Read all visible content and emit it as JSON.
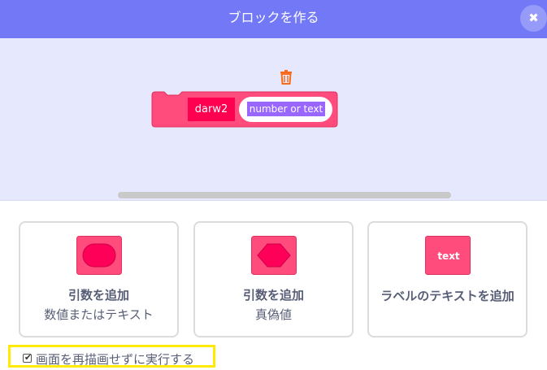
{
  "header": {
    "title": "ブロックを作る",
    "close_icon": "close-icon"
  },
  "workspace": {
    "block": {
      "label": "darw2",
      "input_text": "number or text",
      "color": "#ff4c7c"
    },
    "trash_icon": "trash-icon"
  },
  "options": [
    {
      "title": "引数を追加",
      "subtitle": "数値またはテキスト",
      "icon": "rounded-input-icon"
    },
    {
      "title": "引数を追加",
      "subtitle": "真偽値",
      "icon": "boolean-input-icon"
    },
    {
      "title": "ラベルのテキストを追加",
      "icon_text": "text",
      "icon": "label-text-icon"
    }
  ],
  "warp": {
    "label": "画面を再描画せずに実行する",
    "checked": true
  },
  "colors": {
    "header": "#7378f6",
    "workspace": "#e6e9fd",
    "block": "#ff4c7c",
    "highlight": "#ffea00"
  }
}
